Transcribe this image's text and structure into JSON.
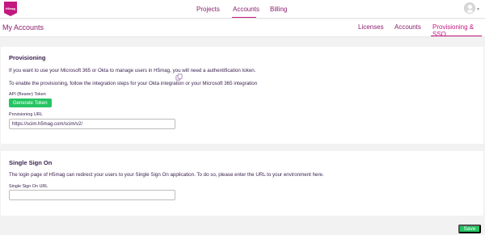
{
  "brand": {
    "logo_text": "H5mag",
    "accent": "#c2187f",
    "green": "#25c463"
  },
  "topnav": {
    "items": [
      {
        "label": "Projects"
      },
      {
        "label": "Accounts"
      },
      {
        "label": "Billing"
      }
    ],
    "active": "Accounts"
  },
  "subheader": {
    "title": "My Accounts",
    "tabs": [
      {
        "label": "Licenses"
      },
      {
        "label": "Accounts"
      },
      {
        "label": "Provisioning & SSO"
      }
    ],
    "active_tab": "Provisioning & SSO"
  },
  "provisioning": {
    "heading": "Provisioning",
    "description": "If you want to use your Microsoft 365 or Okta to manage users in H5mag, you will need a authentification token.",
    "instructions": "To enable the provisioning, follow the integration steps for your Okta integration or your Microsoft 365 integration",
    "token_label": "API (Bearer) Token",
    "token_button": "Generate Token",
    "url_label": "Provisioning URL",
    "url_value": "https://scim.h5mag.com/scim/v2/"
  },
  "sso": {
    "heading": "Single Sign On",
    "description": "The login page of H5mag can redirect your users to your Single Sign On application. To do so, please enter the URL to your environment here.",
    "url_label": "Single Sign On URL",
    "url_value": ""
  },
  "footer": {
    "save_label": "Save"
  }
}
